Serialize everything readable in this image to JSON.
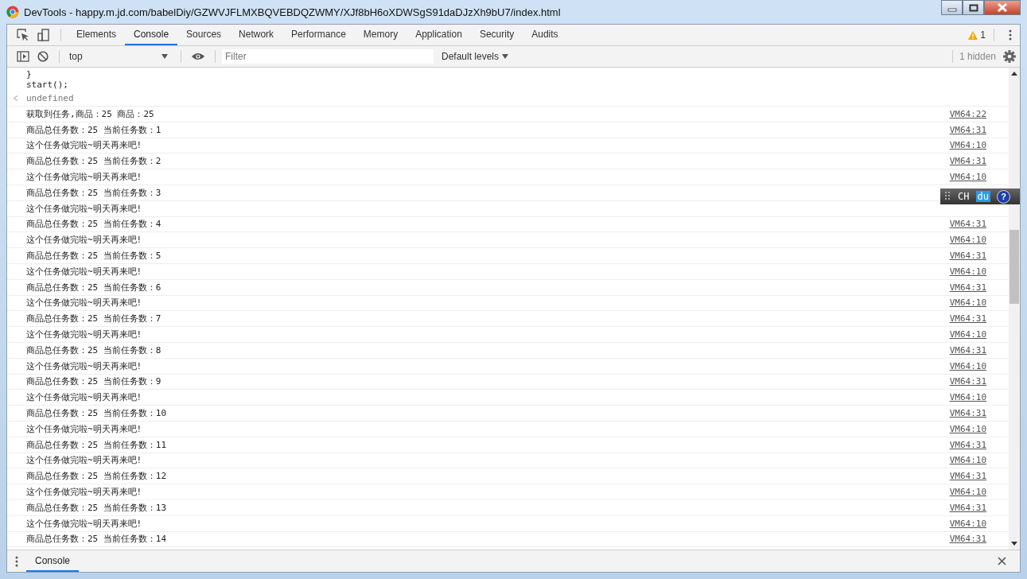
{
  "window": {
    "title": "DevTools - happy.m.jd.com/babelDiy/GZWVJFLMXBQVEBDQZWMY/XJf8bH6oXDWSgS91daDJzXh9bU7/index.html"
  },
  "tabs": [
    {
      "label": "Elements",
      "selected": false
    },
    {
      "label": "Console",
      "selected": true
    },
    {
      "label": "Sources",
      "selected": false
    },
    {
      "label": "Network",
      "selected": false
    },
    {
      "label": "Performance",
      "selected": false
    },
    {
      "label": "Memory",
      "selected": false
    },
    {
      "label": "Application",
      "selected": false
    },
    {
      "label": "Security",
      "selected": false
    },
    {
      "label": "Audits",
      "selected": false
    }
  ],
  "warnings": "1",
  "toolbar": {
    "context": "top",
    "filter_placeholder": "Filter",
    "levels": "Default levels",
    "hidden": "1 hidden"
  },
  "console": {
    "code_lines": [
      "}",
      "start();"
    ],
    "result": "undefined",
    "rows": [
      {
        "text": "获取到任务,商品：25 商品：25",
        "source": "VM64:22"
      },
      {
        "text": "商品总任务数：25 当前任务数：1",
        "source": "VM64:31"
      },
      {
        "text": "这个任务做完啦~明天再来吧!",
        "source": "VM64:10"
      },
      {
        "text": "商品总任务数：25 当前任务数：2",
        "source": "VM64:31"
      },
      {
        "text": "这个任务做完啦~明天再来吧!",
        "source": "VM64:10"
      },
      {
        "text": "商品总任务数：25 当前任务数：3"
      },
      {
        "text": "这个任务做完啦~明天再来吧!"
      },
      {
        "text": "商品总任务数：25 当前任务数：4",
        "source": "VM64:31"
      },
      {
        "text": "这个任务做完啦~明天再来吧!",
        "source": "VM64:10"
      },
      {
        "text": "商品总任务数：25 当前任务数：5",
        "source": "VM64:31"
      },
      {
        "text": "这个任务做完啦~明天再来吧!",
        "source": "VM64:10"
      },
      {
        "text": "商品总任务数：25 当前任务数：6",
        "source": "VM64:31"
      },
      {
        "text": "这个任务做完啦~明天再来吧!",
        "source": "VM64:10"
      },
      {
        "text": "商品总任务数：25 当前任务数：7",
        "source": "VM64:31"
      },
      {
        "text": "这个任务做完啦~明天再来吧!",
        "source": "VM64:10"
      },
      {
        "text": "商品总任务数：25 当前任务数：8",
        "source": "VM64:31"
      },
      {
        "text": "这个任务做完啦~明天再来吧!",
        "source": "VM64:10"
      },
      {
        "text": "商品总任务数：25 当前任务数：9",
        "source": "VM64:31"
      },
      {
        "text": "这个任务做完啦~明天再来吧!",
        "source": "VM64:10"
      },
      {
        "text": "商品总任务数：25 当前任务数：10",
        "source": "VM64:31"
      },
      {
        "text": "这个任务做完啦~明天再来吧!",
        "source": "VM64:10"
      },
      {
        "text": "商品总任务数：25 当前任务数：11",
        "source": "VM64:31"
      },
      {
        "text": "这个任务做完啦~明天再来吧!",
        "source": "VM64:10"
      },
      {
        "text": "商品总任务数：25 当前任务数：12",
        "source": "VM64:31"
      },
      {
        "text": "这个任务做完啦~明天再来吧!",
        "source": "VM64:10"
      },
      {
        "text": "商品总任务数：25 当前任务数：13",
        "source": "VM64:31"
      },
      {
        "text": "这个任务做完啦~明天再来吧!",
        "source": "VM64:10"
      },
      {
        "text": "商品总任务数：25 当前任务数：14",
        "source": "VM64:31"
      }
    ]
  },
  "ime_bar": {
    "language": "CH",
    "badge": "du",
    "help": "?"
  },
  "drawer": {
    "tabs": [
      {
        "label": "Console",
        "selected": true
      }
    ]
  }
}
